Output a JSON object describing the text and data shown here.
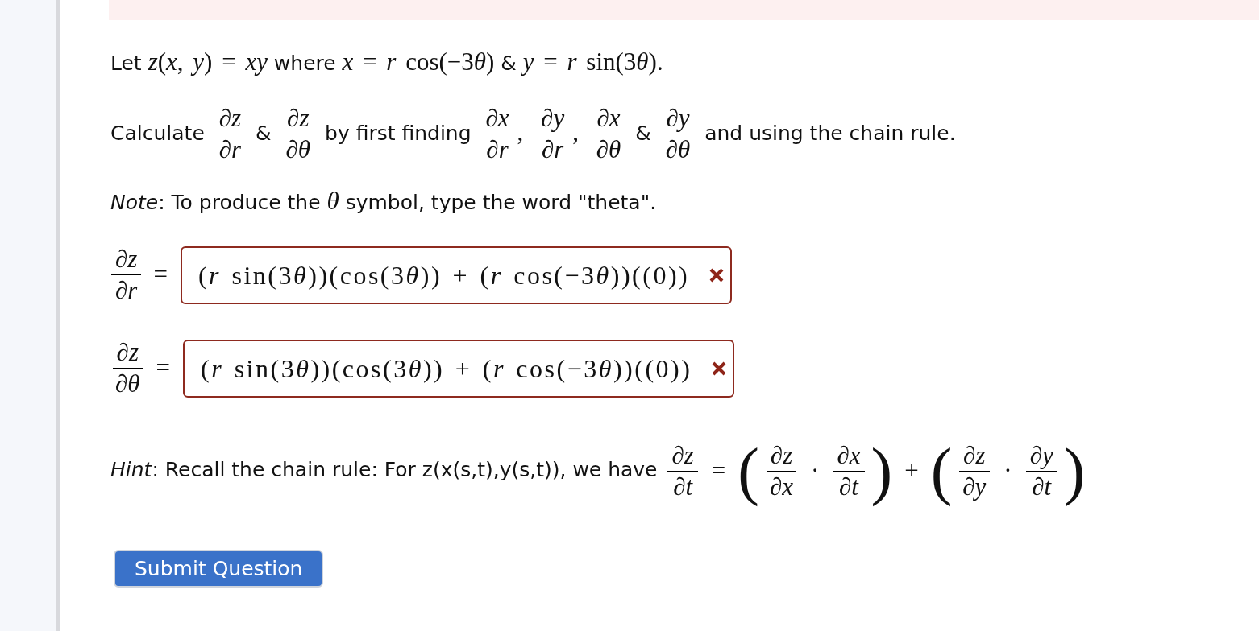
{
  "statement": [
    {
      "kind": "text",
      "text": "Let "
    },
    {
      "kind": "math",
      "text": "*z*(*x*, *y*) = *xy*"
    },
    {
      "kind": "text",
      "text": " where "
    },
    {
      "kind": "math",
      "text": "*x* = *r* cos(−3⁠*θ*)"
    },
    {
      "kind": "text",
      "text": " & "
    },
    {
      "kind": "math",
      "text": "*y* = *r* sin(3⁠*θ*)."
    }
  ],
  "instruction": [
    {
      "kind": "text",
      "text": "Calculate "
    },
    {
      "kind": "frac",
      "num": "∂*z*",
      "den": "∂*r*"
    },
    {
      "kind": "text",
      "text": " & "
    },
    {
      "kind": "frac",
      "num": "∂*z*",
      "den": "∂*θ*"
    },
    {
      "kind": "text",
      "text": " by first finding "
    },
    {
      "kind": "frac",
      "num": "∂*x*",
      "den": "∂*r*"
    },
    {
      "kind": "math",
      "text": ", "
    },
    {
      "kind": "frac",
      "num": "∂*y*",
      "den": "∂*r*"
    },
    {
      "kind": "math",
      "text": ", "
    },
    {
      "kind": "frac",
      "num": "∂*x*",
      "den": "∂*θ*"
    },
    {
      "kind": "text",
      "text": " & "
    },
    {
      "kind": "frac",
      "num": "∂*y*",
      "den": "∂*θ*"
    },
    {
      "kind": "text",
      "text": " and using the chain rule."
    }
  ],
  "note": [
    {
      "kind": "text",
      "text": "*Note*: To produce the "
    },
    {
      "kind": "math",
      "text": "*θ*"
    },
    {
      "kind": "text",
      "text": " symbol, type the word \"theta\"."
    }
  ],
  "answers": [
    {
      "label": {
        "num": "∂*z*",
        "den": "∂*r*"
      },
      "relation": "=",
      "value": "(*r* sin(3⁠*θ*))(cos(3⁠*θ*)) + (*r* cos(−3⁠*θ*))((0))",
      "correct": false
    },
    {
      "label": {
        "num": "∂*z*",
        "den": "∂*θ*"
      },
      "relation": "=",
      "value": "(*r* sin(3⁠*θ*))(cos(3⁠*θ*)) + (*r* cos(−3⁠*θ*))((0))",
      "correct": false
    }
  ],
  "hint": [
    {
      "kind": "text",
      "text": "*Hint*: Recall the chain rule: For z(x(s,t),y(s,t)), we have "
    },
    {
      "kind": "frac",
      "num": "∂*z*",
      "den": "∂*t*"
    },
    {
      "kind": "op",
      "text": "="
    },
    {
      "kind": "paren",
      "text": "("
    },
    {
      "kind": "frac",
      "num": "∂*z*",
      "den": "∂*x*"
    },
    {
      "kind": "op",
      "text": "·"
    },
    {
      "kind": "frac",
      "num": "∂*x*",
      "den": "∂*t*"
    },
    {
      "kind": "paren",
      "text": ")"
    },
    {
      "kind": "op",
      "text": "+"
    },
    {
      "kind": "paren",
      "text": "("
    },
    {
      "kind": "frac",
      "num": "∂*z*",
      "den": "∂*y*"
    },
    {
      "kind": "op",
      "text": "·"
    },
    {
      "kind": "frac",
      "num": "∂*y*",
      "den": "∂*t*"
    },
    {
      "kind": "paren",
      "text": ")"
    }
  ],
  "submit": {
    "label": "Submit Question"
  }
}
